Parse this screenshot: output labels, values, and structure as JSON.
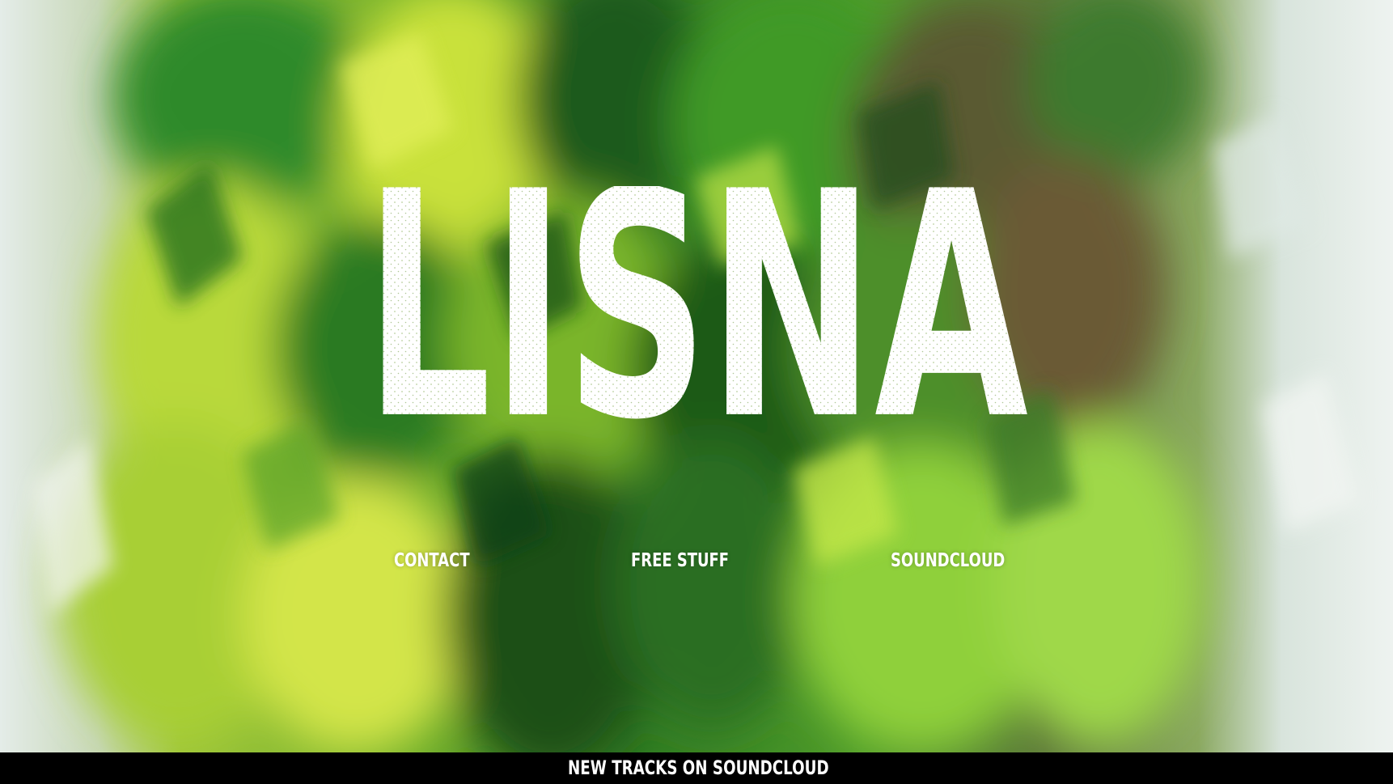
{
  "site": {
    "logo_text": "LISNA"
  },
  "nav": {
    "items": [
      {
        "label": "CONTACT"
      },
      {
        "label": "FREE STUFF"
      },
      {
        "label": "SOUNDCLOUD"
      }
    ]
  },
  "footer": {
    "banner_label": "NEW TRACKS ON SOUNDCLOUD"
  },
  "colors": {
    "text": "#ffffff",
    "footer_bg": "#000000",
    "leaf_dark": "#1f5a17",
    "leaf_mid": "#4f9a1e",
    "leaf_light": "#b8d933",
    "edge_pale": "#e2ece8"
  }
}
